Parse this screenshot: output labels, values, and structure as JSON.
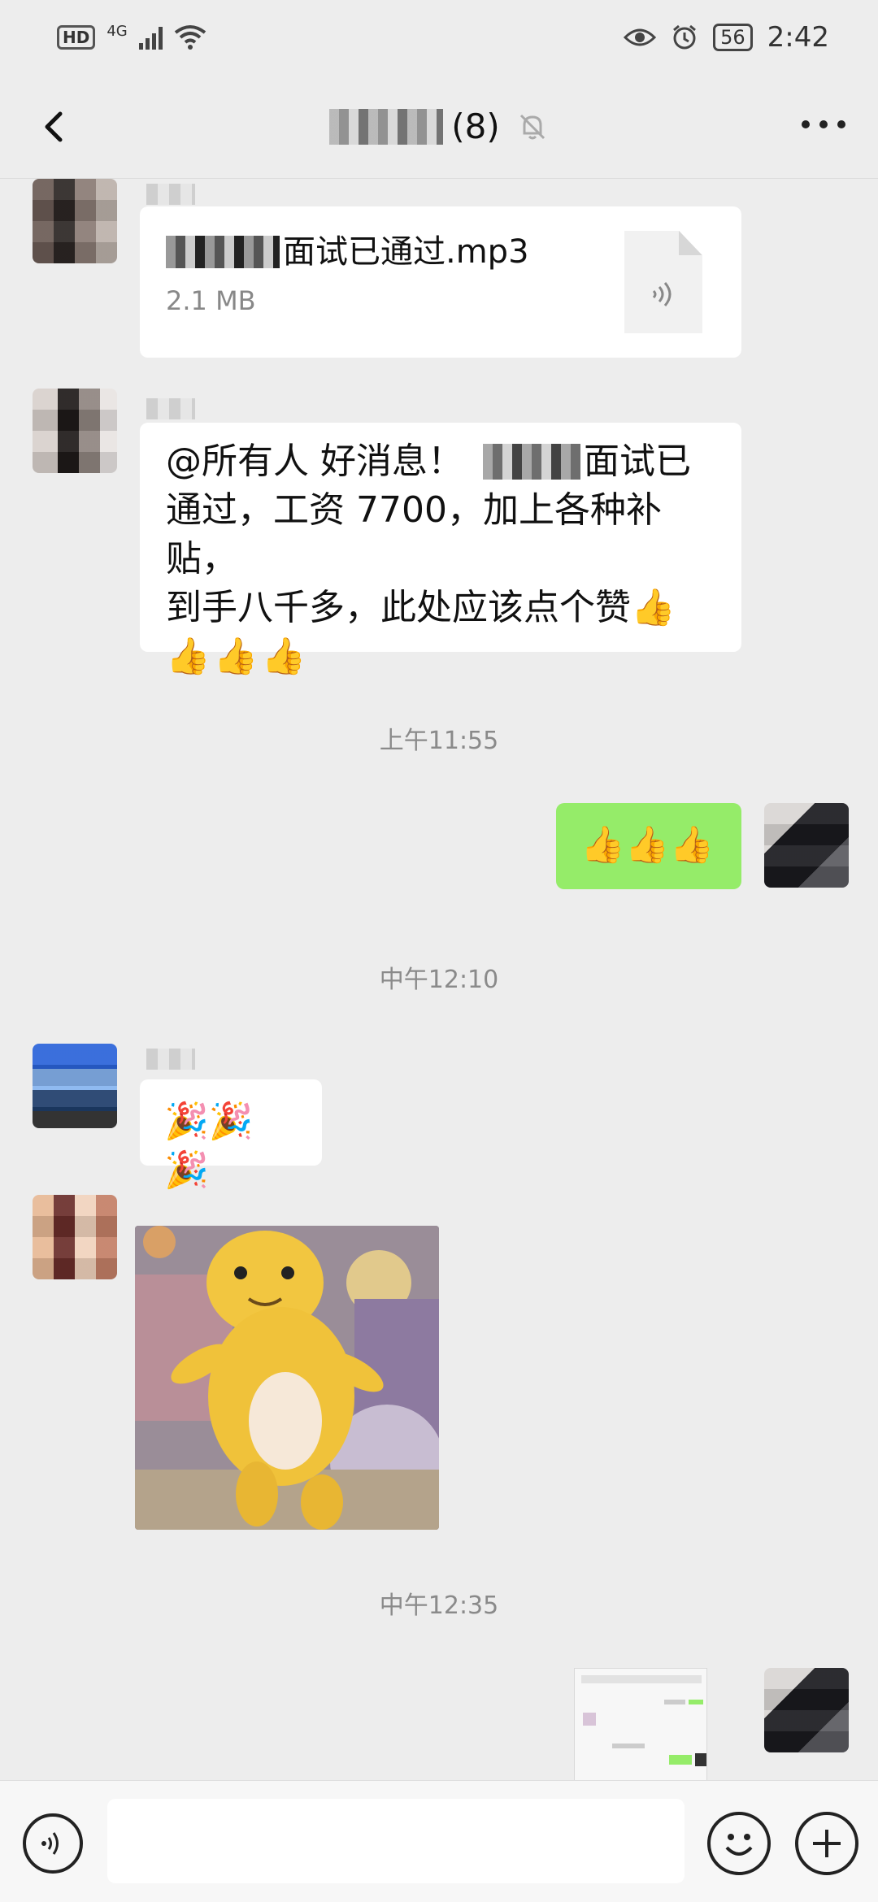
{
  "status_bar": {
    "hd": "HD",
    "network": "4G",
    "battery": "56",
    "time": "2:42"
  },
  "header": {
    "count": "(8)"
  },
  "messages": {
    "file": {
      "name": "面试已通过.mp3",
      "size": "2.1 MB"
    },
    "announcement": {
      "line1_prefix": "@所有人  好消息！",
      "line1_suffix": "面试已",
      "line2": "通过，工资 7700，加上各种补贴，",
      "line3": "到手八千多，此处应该点个赞",
      "emoji": "👍"
    },
    "time1": "上午11:55",
    "my_reply": "👍👍👍",
    "time2": "中午12:10",
    "party": "🎉🎉🎉",
    "time3": "中午12:35"
  },
  "colors": {
    "bg": "#ededed",
    "self_bubble": "#95ec69",
    "other_bubble": "#ffffff"
  }
}
